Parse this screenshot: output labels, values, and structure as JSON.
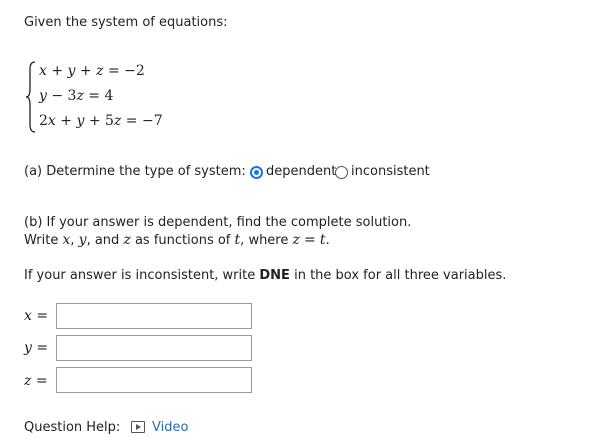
{
  "question": {
    "intro": "Given the system of equations:",
    "equations": [
      {
        "parts": [
          "x",
          " + ",
          "y",
          " + ",
          "z",
          " = −2"
        ]
      },
      {
        "parts": [
          "y",
          " − 3",
          "z",
          " = 4"
        ]
      },
      {
        "parts": [
          "2",
          "x",
          " + ",
          "y",
          " + 5",
          "z",
          " = −7"
        ]
      }
    ]
  },
  "part_a": {
    "prompt": "(a) Determine the type of system:",
    "options": [
      {
        "label": "dependent",
        "selected": true
      },
      {
        "label": "inconsistent",
        "selected": false
      }
    ]
  },
  "part_b": {
    "line1": "(b) If your answer is dependent, find the complete solution.",
    "line2_prefix": "Write",
    "line2_x": "x",
    "line2_y": "y",
    "line2_and": "and",
    "line2_z": "z",
    "line2_mid": "as functions of",
    "line2_t": "t",
    "line2_where": "where",
    "line2_eq_z": "z",
    "line2_eq": "=",
    "line2_eq_t": "t",
    "inconsistent_prefix": "If your answer is inconsistent, write",
    "inconsistent_bold": "DNE",
    "inconsistent_suffix": "in the box for all three variables."
  },
  "answers": [
    {
      "var": "x",
      "value": ""
    },
    {
      "var": "y",
      "value": ""
    },
    {
      "var": "z",
      "value": ""
    }
  ],
  "help": {
    "label": "Question Help:",
    "video_label": "Video",
    "video_icon": "video-icon"
  },
  "colors": {
    "accent": "#1a73e8",
    "link": "#2b6cb0",
    "text": "#222222"
  }
}
